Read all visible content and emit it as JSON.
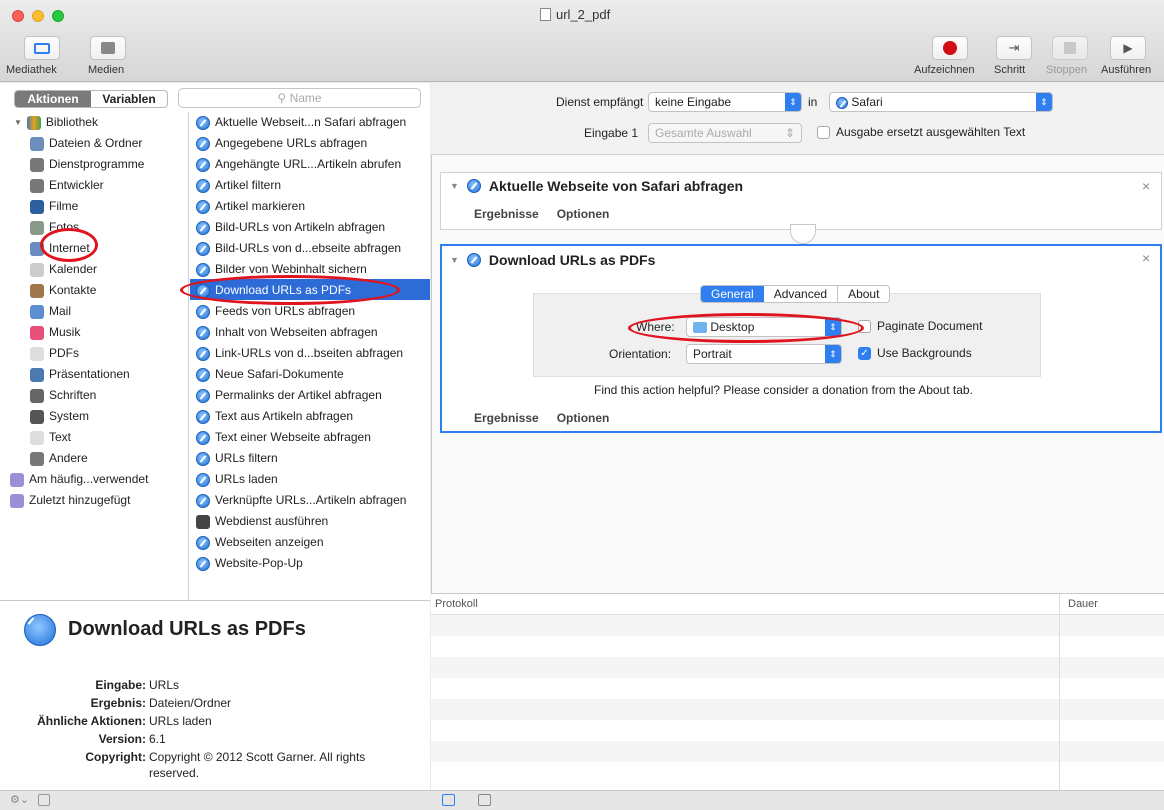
{
  "window": {
    "title": "url_2_pdf"
  },
  "toolbar": {
    "left": [
      {
        "label": "Mediathek",
        "icon": "sidebar-icon"
      },
      {
        "label": "Medien",
        "icon": "media-icon"
      }
    ],
    "right": [
      {
        "label": "Aufzeichnen",
        "icon": "record-icon"
      },
      {
        "label": "Schritt",
        "icon": "step-icon"
      },
      {
        "label": "Stoppen",
        "icon": "stop-icon"
      },
      {
        "label": "Ausführen",
        "icon": "play-icon"
      }
    ]
  },
  "tabs": {
    "actions": "Aktionen",
    "variables": "Variablen"
  },
  "search": {
    "placeholder": "Name"
  },
  "library": {
    "root": "Bibliothek",
    "items": [
      {
        "label": "Dateien & Ordner",
        "color": "#6b8fb8"
      },
      {
        "label": "Dienstprogramme",
        "color": "#777777"
      },
      {
        "label": "Entwickler",
        "color": "#777777"
      },
      {
        "label": "Filme",
        "color": "#2b5f9e"
      },
      {
        "label": "Fotos",
        "color": "#8a9a8a"
      },
      {
        "label": "Internet",
        "color": "#6a8cc0"
      },
      {
        "label": "Kalender",
        "color": "#cccccc"
      },
      {
        "label": "Kontakte",
        "color": "#a0764a"
      },
      {
        "label": "Mail",
        "color": "#5d8fd0"
      },
      {
        "label": "Musik",
        "color": "#e8507a"
      },
      {
        "label": "PDFs",
        "color": "#dddddd"
      },
      {
        "label": "Präsentationen",
        "color": "#4a7ab0"
      },
      {
        "label": "Schriften",
        "color": "#666666"
      },
      {
        "label": "System",
        "color": "#555555"
      },
      {
        "label": "Text",
        "color": "#dddddd"
      },
      {
        "label": "Andere",
        "color": "#777777"
      }
    ],
    "smart": [
      "Am häufig...verwendet",
      "Zuletzt hinzugefügt"
    ]
  },
  "actions": [
    "Aktuelle Webseit...n Safari abfragen",
    "Angegebene URLs abfragen",
    "Angehängte URL...Artikeln abrufen",
    "Artikel filtern",
    "Artikel markieren",
    "Bild-URLs von Artikeln abfragen",
    "Bild-URLs von d...ebseite abfragen",
    "Bilder von Webinhalt sichern",
    "Download URLs as PDFs",
    "Feeds von URLs abfragen",
    "Inhalt von Webseiten abfragen",
    "Link-URLs von d...bseiten abfragen",
    "Neue Safari-Dokumente",
    "Permalinks der Artikel abfragen",
    "Text aus Artikeln abfragen",
    "Text einer Webseite abfragen",
    "URLs filtern",
    "URLs laden",
    "Verknüpfte URLs...Artikeln abfragen",
    "Webdienst ausführen",
    "Webseiten anzeigen",
    "Website-Pop-Up"
  ],
  "description": {
    "title": "Download URLs as PDFs",
    "fields": [
      {
        "key": "Eingabe:",
        "value": "URLs"
      },
      {
        "key": "Ergebnis:",
        "value": "Dateien/Ordner"
      },
      {
        "key": "Ähnliche Aktionen:",
        "value": "URLs laden"
      },
      {
        "key": "Version:",
        "value": "6.1"
      },
      {
        "key": "Copyright:",
        "value": "Copyright © 2012 Scott Garner. All rights",
        "value2": "reserved."
      }
    ]
  },
  "service": {
    "receives_label": "Dienst empfängt",
    "receives_value": "keine Eingabe",
    "in_label": "in",
    "app_value": "Safari",
    "input_label": "Eingabe 1",
    "input_value": "Gesamte Auswahl",
    "replace_label": "Ausgabe ersetzt ausgewählten Text"
  },
  "workflow": {
    "action1": {
      "title": "Aktuelle Webseite von Safari abfragen",
      "results": "Ergebnisse",
      "options": "Optionen"
    },
    "action2": {
      "title": "Download URLs as PDFs",
      "tabs": [
        "General",
        "Advanced",
        "About"
      ],
      "where_label": "Where:",
      "where_value": "Desktop",
      "paginate_label": "Paginate Document",
      "orientation_label": "Orientation:",
      "orientation_value": "Portrait",
      "backgrounds_label": "Use Backgrounds",
      "donation": "Find this action helpful? Please consider a donation from the About tab.",
      "results": "Ergebnisse",
      "options": "Optionen"
    }
  },
  "log": {
    "col1": "Protokoll",
    "col2": "Dauer"
  },
  "colors": {
    "selection": "#2d6bd6",
    "accent": "#2f7ff0",
    "annotation": "#e0141e"
  }
}
